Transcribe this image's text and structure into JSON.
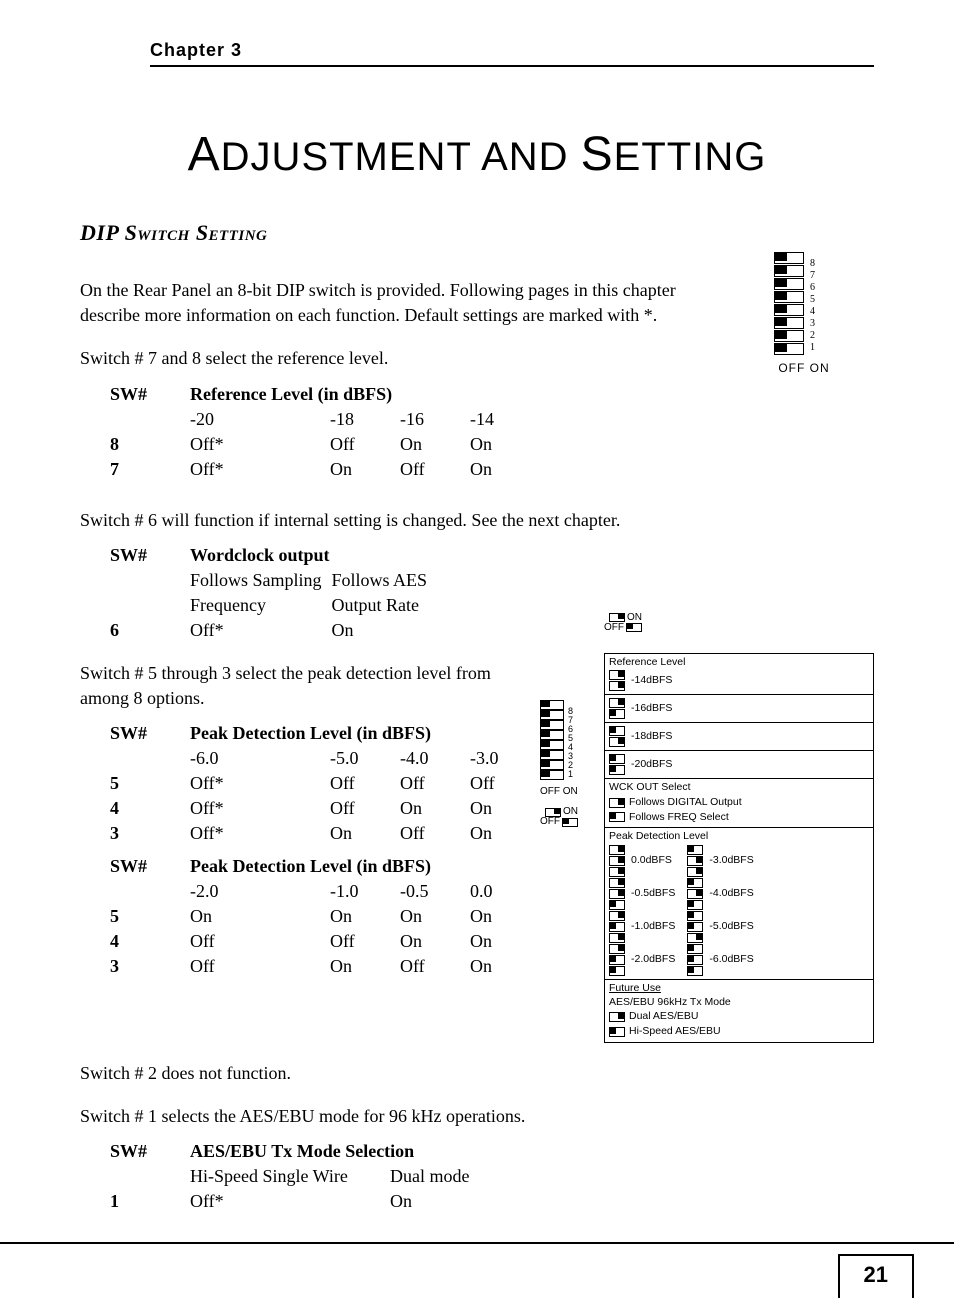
{
  "chapter": "Chapter 3",
  "title_part1_cap": "A",
  "title_part1": "DJUSTMENT AND ",
  "title_part2_cap": "S",
  "title_part2": "ETTING",
  "section_heading": "DIP Switch Setting",
  "intro_p1": "On the Rear Panel an 8-bit DIP switch is provided. Following pages in this chapter describe more information on each function. Default settings are marked with *.",
  "intro_p2": "Switch # 7 and 8 select the reference level.",
  "table1": {
    "h_sw": "SW#",
    "h_ref": "Reference Level (in dBFS)",
    "cols": [
      "-20",
      "-18",
      "-16",
      "-14"
    ],
    "rows": [
      {
        "sw": "8",
        "v": [
          "Off*",
          "Off",
          "On",
          "On"
        ]
      },
      {
        "sw": "7",
        "v": [
          "Off*",
          "On",
          "Off",
          "On"
        ]
      }
    ]
  },
  "after_t1": "Switch # 6 will function if internal setting is changed. See the next chapter.",
  "table2": {
    "h_sw": "SW#",
    "h_wc": "Wordclock output",
    "c1a": "Follows Sampling",
    "c1b": "Frequency",
    "c2a": "Follows AES",
    "c2b": "Output Rate",
    "row": {
      "sw": "6",
      "v": [
        "Off*",
        "On"
      ]
    }
  },
  "after_t2": "Switch # 5 through 3 select the peak detection level from among 8 options.",
  "table3a": {
    "h_sw": "SW#",
    "h_pd": "Peak Detection Level (in dBFS)",
    "cols": [
      "-6.0",
      "-5.0",
      "-4.0",
      "-3.0"
    ],
    "rows": [
      {
        "sw": "5",
        "v": [
          "Off*",
          "Off",
          "Off",
          "Off"
        ]
      },
      {
        "sw": "4",
        "v": [
          "Off*",
          "Off",
          "On",
          "On"
        ]
      },
      {
        "sw": "3",
        "v": [
          "Off*",
          "On",
          "Off",
          "On"
        ]
      }
    ]
  },
  "table3b": {
    "h_sw": "SW#",
    "h_pd": "Peak Detection Level (in dBFS)",
    "cols": [
      "-2.0",
      "-1.0",
      "-0.5",
      "0.0"
    ],
    "rows": [
      {
        "sw": "5",
        "v": [
          "On",
          "On",
          "On",
          "On"
        ]
      },
      {
        "sw": "4",
        "v": [
          "Off",
          "Off",
          "On",
          "On"
        ]
      },
      {
        "sw": "3",
        "v": [
          "Off",
          "On",
          "Off",
          "On"
        ]
      }
    ]
  },
  "after_t3_1": "Switch # 2 does not function.",
  "after_t3_2": "Switch # 1 selects the AES/EBU mode for 96 kHz operations.",
  "table4": {
    "h_sw": "SW#",
    "h_mode": "AES/EBU Tx Mode Selection",
    "c1": "Hi-Speed Single Wire",
    "c2": "Dual mode",
    "row": {
      "sw": "1",
      "v": [
        "Off*",
        "On"
      ]
    }
  },
  "offon": "OFF ON",
  "offon2": "OFF ON",
  "side_on": "ON",
  "side_off": "OFF",
  "ref": {
    "title": "Reference Level",
    "r14": "-14dBFS",
    "r16": "-16dBFS",
    "r18": "-18dBFS",
    "r20": "-20dBFS",
    "wck_title": "WCK OUT Select",
    "wck_1": "Follows DIGITAL Output",
    "wck_2": "Follows FREQ Select",
    "pdl_title": "Peak Detection Level",
    "pdl": [
      "0.0dBFS",
      "-3.0dBFS",
      "-0.5dBFS",
      "-4.0dBFS",
      "-1.0dBFS",
      "-5.0dBFS",
      "-2.0dBFS",
      "-6.0dBFS"
    ],
    "future": "Future Use",
    "aes_title": "AES/EBU 96kHz Tx Mode",
    "aes_1": "Dual AES/EBU",
    "aes_2": "Hi-Speed AES/EBU"
  },
  "page_number": "21"
}
